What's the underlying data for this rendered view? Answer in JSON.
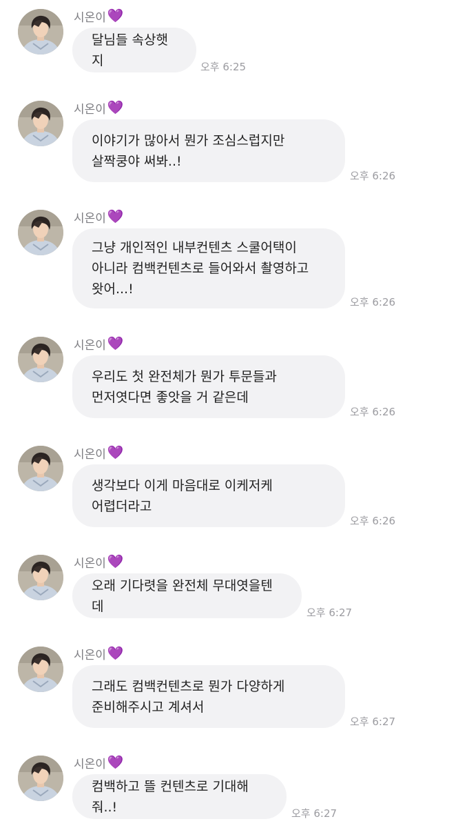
{
  "messages": [
    {
      "sender": "시온이",
      "heart": "💜",
      "text": "달님들 속상햇지",
      "time": "오후 6:25"
    },
    {
      "sender": "시온이",
      "heart": "💜",
      "text": "이야기가 많아서 뭔가 조심스럽지만\n살짝쿵야 써봐..!",
      "time": "오후 6:26"
    },
    {
      "sender": "시온이",
      "heart": "💜",
      "text": "그냥 개인적인 내부컨텐츠 스쿨어택이\n아니라 컴백컨텐츠로 들어와서 촬영하고\n왓어...!",
      "time": "오후 6:26"
    },
    {
      "sender": "시온이",
      "heart": "💜",
      "text": "우리도 첫 완전체가 뭔가 투문들과\n먼저엿다면 좋앗을 거 같은데",
      "time": "오후 6:26"
    },
    {
      "sender": "시온이",
      "heart": "💜",
      "text": "생각보다 이게 마음대로 이케저케\n어렵더라고",
      "time": "오후 6:26"
    },
    {
      "sender": "시온이",
      "heart": "💜",
      "text": "오래 기다렷을 완전체 무대엿을텐데",
      "time": "오후 6:27"
    },
    {
      "sender": "시온이",
      "heart": "💜",
      "text": "그래도 컴백컨텐츠로 뭔가 다양하게\n준비해주시고 계셔서",
      "time": "오후 6:27"
    },
    {
      "sender": "시온이",
      "heart": "💜",
      "text": "컴백하고 뜰 컨텐츠로 기대해줘..!",
      "time": "오후 6:27"
    }
  ],
  "colors": {
    "bubble": "#f2f2f4",
    "text": "#222222",
    "name": "#7d7d82",
    "time": "#9b9ba0",
    "heart": "#8a2be2"
  },
  "icons": {
    "avatar": "profile-photo"
  }
}
